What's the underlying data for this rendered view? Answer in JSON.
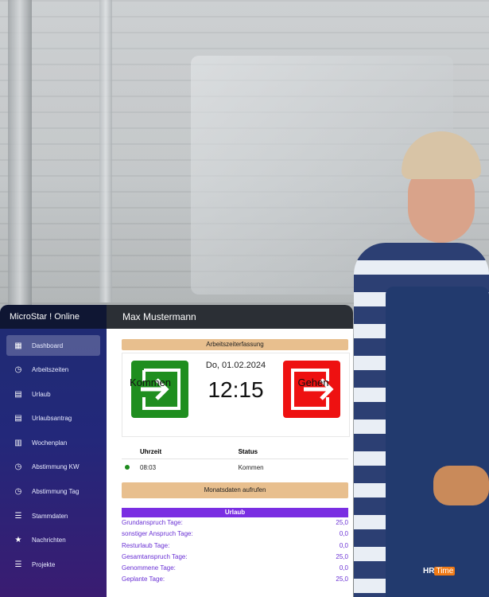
{
  "app": {
    "name": "MicroStar ! Online",
    "user": "Max Mustermann"
  },
  "sidebar": {
    "items": [
      {
        "label": "Dashboard",
        "icon": "grid-icon",
        "active": true
      },
      {
        "label": "Arbeitszeiten",
        "icon": "clock-icon"
      },
      {
        "label": "Urlaub",
        "icon": "calendar-icon"
      },
      {
        "label": "Urlaubsantrag",
        "icon": "calendar-icon"
      },
      {
        "label": "Wochenplan",
        "icon": "calendar-icon"
      },
      {
        "label": "Abstimmung KW",
        "icon": "clock-icon"
      },
      {
        "label": "Abstimmung Tag",
        "icon": "clock-icon"
      },
      {
        "label": "Stammdaten",
        "icon": "list-icon"
      },
      {
        "label": "Nachrichten",
        "icon": "star-icon"
      },
      {
        "label": "Projekte",
        "icon": "list-icon"
      }
    ]
  },
  "timeclock": {
    "section_title": "Arbeitszeiterfassung",
    "date": "Do, 01.02.2024",
    "time": "12:15",
    "in_label": "Kommen",
    "out_label": "Gehen",
    "in_color": "#1f8e1f",
    "out_color": "#ee1111"
  },
  "log_table": {
    "headers": [
      "Uhrzeit",
      "Status"
    ],
    "rows": [
      {
        "time": "08:03",
        "status": "Kommen"
      }
    ]
  },
  "month_button": "Monatsdaten aufrufen",
  "vacation": {
    "title": "Urlaub",
    "rows": [
      {
        "label": "Grundanspruch Tage:",
        "value": "25,0"
      },
      {
        "label": "sonstiger Anspruch Tage:",
        "value": "0,0"
      },
      {
        "label": "Resturlaub Tage:",
        "value": "0,0"
      },
      {
        "label": "Gesamtanspruch Tage:",
        "value": "25,0"
      },
      {
        "label": "Genommene Tage:",
        "value": "0,0"
      },
      {
        "label": "Geplante Tage:",
        "value": "25,0"
      }
    ]
  },
  "logo": {
    "prefix": "HR",
    "suffix": "Time"
  }
}
